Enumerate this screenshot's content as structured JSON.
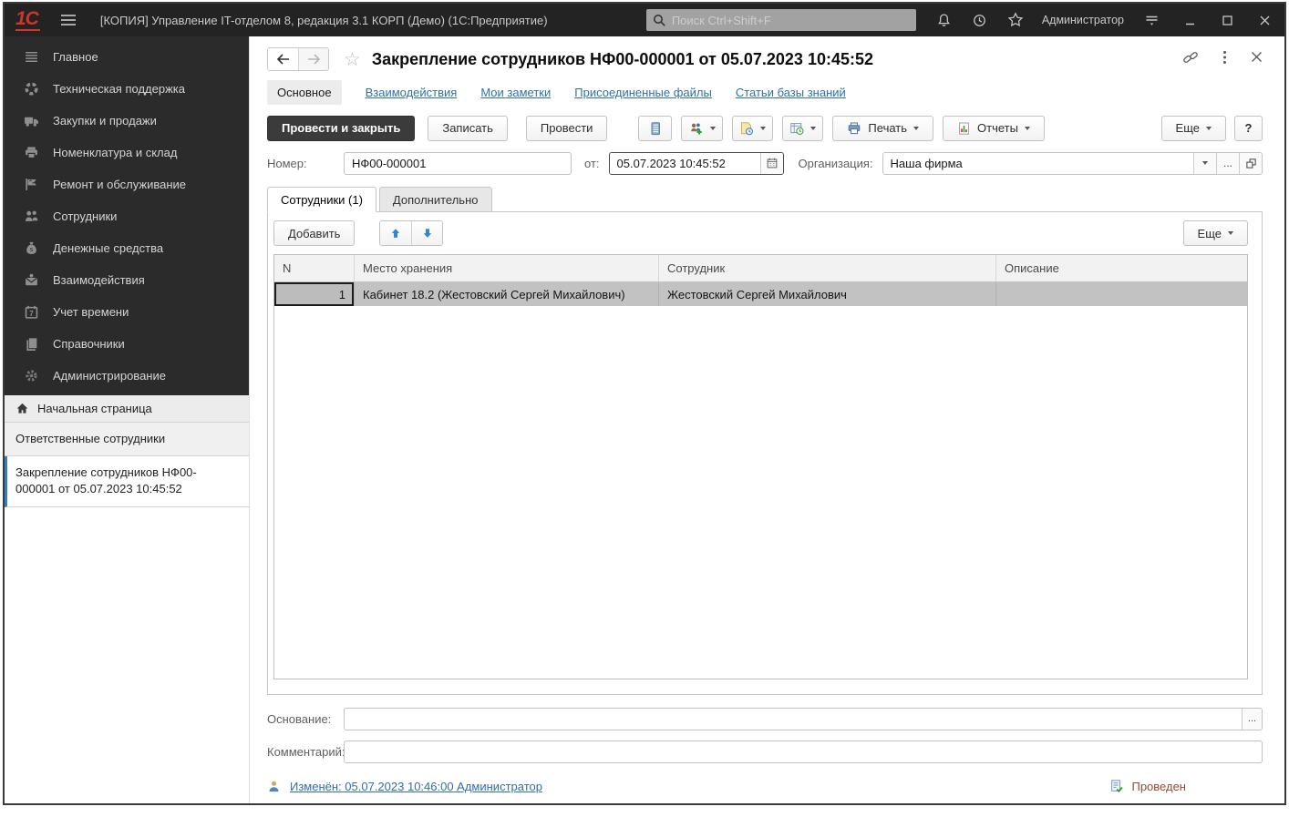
{
  "colors": {
    "accent_blue": "#2f6fad",
    "titlebar_bg": "#232323",
    "sidebar_bg": "#2b2b2b",
    "logo_red": "#d3342a",
    "selected_row_grey": "#c2c2c2",
    "status_red": "#944a32",
    "primary_button_bg": "#3b3b3b"
  },
  "titlebar": {
    "logo": "1С",
    "app_title": "[КОПИЯ] Управление IT-отделом 8, редакция 3.1 КОРП (Демо)  (1С:Предприятие)",
    "search_placeholder": "Поиск Ctrl+Shift+F",
    "user": "Администратор"
  },
  "sidebar": {
    "items": [
      {
        "label": "Главное"
      },
      {
        "label": "Техническая поддержка"
      },
      {
        "label": "Закупки и продажи"
      },
      {
        "label": "Номенклатура и склад"
      },
      {
        "label": "Ремонт и обслуживание"
      },
      {
        "label": "Сотрудники"
      },
      {
        "label": "Денежные средства"
      },
      {
        "label": "Взаимодействия"
      },
      {
        "label": "Учет времени"
      },
      {
        "label": "Справочники"
      },
      {
        "label": "Администрирование"
      }
    ],
    "home_label": "Начальная страница",
    "windows": [
      {
        "label": "Ответственные сотрудники",
        "active": false
      },
      {
        "label": "Закрепление сотрудников НФ00-000001 от 05.07.2023 10:45:52",
        "active": true
      }
    ]
  },
  "page": {
    "title": "Закрепление сотрудников НФ00-000001 от 05.07.2023 10:45:52",
    "nav": [
      {
        "label": "Основное",
        "active": true
      },
      {
        "label": "Взаимодействия",
        "active": false
      },
      {
        "label": "Мои заметки",
        "active": false
      },
      {
        "label": "Присоединенные файлы",
        "active": false
      },
      {
        "label": "Статьи базы знаний",
        "active": false
      }
    ]
  },
  "toolbar": {
    "post_and_close": "Провести и закрыть",
    "write": "Записать",
    "post": "Провести",
    "print": "Печать",
    "reports": "Отчеты",
    "more": "Еще",
    "help": "?"
  },
  "fields": {
    "number_label": "Номер:",
    "number_value": "НФ00-000001",
    "date_label": "от:",
    "date_value": "05.07.2023 10:45:52",
    "org_label": "Организация:",
    "org_value": "Наша фирма",
    "org_ellipsis": "...",
    "basis_ellipsis": "..."
  },
  "tabs": {
    "employees": "Сотрудники (1)",
    "additional": "Дополнительно"
  },
  "grid": {
    "add_button": "Добавить",
    "more_button": "Еще",
    "columns": [
      "N",
      "Место хранения",
      "Сотрудник",
      "Описание"
    ],
    "rows": [
      {
        "n": "1",
        "storage_place": "Кабинет 18.2 (Жестовский Сергей Михайлович)",
        "employee": "Жестовский Сергей Михайлович",
        "description": ""
      }
    ]
  },
  "bottom": {
    "basis_label": "Основание:",
    "basis_value": "",
    "comment_label": "Комментарий:",
    "comment_value": ""
  },
  "statusbar": {
    "modified": "Изменён: 05.07.2023 10:46:00 Администратор",
    "status": "Проведен"
  }
}
